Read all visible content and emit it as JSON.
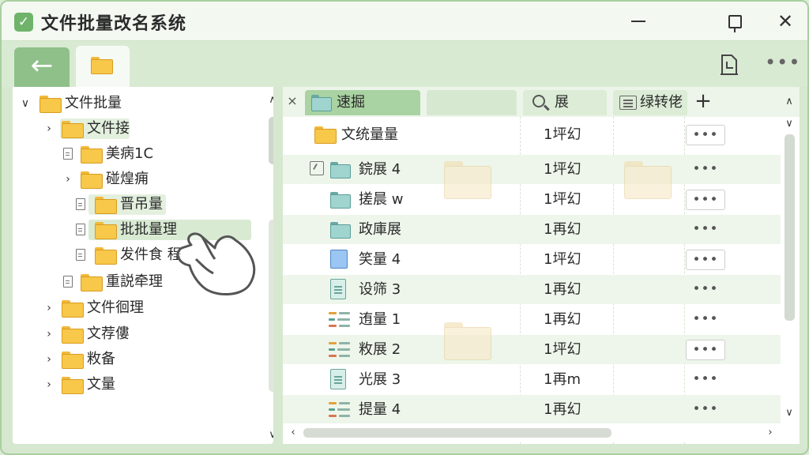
{
  "window": {
    "title": "文件批量改名系统",
    "icons": {
      "app": "check-icon",
      "minimize": "minimize-icon",
      "maximize": "maximize-icon",
      "close": "close-icon",
      "close_glyph": "✕"
    },
    "colors": {
      "accent": "#6fb36a",
      "background": "#d6e8cf",
      "highlight": "#e3f0de"
    }
  },
  "toolbar": {
    "back_glyph": "←",
    "more_glyph": "•••"
  },
  "tree": {
    "items": [
      {
        "label": "文件批量",
        "arrow": "∨",
        "has_doc": false
      },
      {
        "label": "文件接",
        "arrow": "›",
        "has_doc": false
      },
      {
        "label": "美病1C",
        "arrow": "",
        "has_doc": true
      },
      {
        "label": "碰煌痈",
        "arrow": "›",
        "has_doc": false
      },
      {
        "label": "晋吊量",
        "arrow": "",
        "has_doc": true
      },
      {
        "label": "批批量理",
        "arrow": "",
        "has_doc": true
      },
      {
        "label": "发件食 程",
        "arrow": "",
        "has_doc": true
      },
      {
        "label": "重説牵理",
        "arrow": "",
        "has_doc": true
      },
      {
        "label": "文件徊理",
        "arrow": "›",
        "has_doc": false
      },
      {
        "label": "文荐僂",
        "arrow": "›",
        "has_doc": false
      },
      {
        "label": "敉备",
        "arrow": "›",
        "has_doc": false
      },
      {
        "label": "文量",
        "arrow": "›",
        "has_doc": false
      }
    ],
    "scroll_up": "∧",
    "scroll_down": "∨"
  },
  "tabs": {
    "close_glyph": "×",
    "items": [
      {
        "label": "速掘"
      },
      {
        "label": ""
      },
      {
        "label": "展"
      },
      {
        "label": "绿转佬"
      }
    ],
    "add_glyph": "+"
  },
  "files": {
    "rows": [
      {
        "name": "文统量量",
        "size": "1坪幻",
        "icon": "folder-icon",
        "dots": "•••"
      },
      {
        "name": "鋎展 4",
        "size": "1坪幻",
        "icon": "teal-folder-icon",
        "dots": "•••"
      },
      {
        "name": "搓晨 w",
        "size": "1坪幻",
        "icon": "teal-folder-icon",
        "dots": "•••"
      },
      {
        "name": "政庫展",
        "size": "1再幻",
        "icon": "teal-folder-icon",
        "dots": "•••"
      },
      {
        "name": "笑量 4",
        "size": "1坪幻",
        "icon": "blue-file-icon",
        "dots": "•••"
      },
      {
        "name": "设筛 3",
        "size": "1再幻",
        "icon": "document-icon",
        "dots": "•••"
      },
      {
        "name": "迶量 1",
        "size": "1再幻",
        "icon": "list-file-icon",
        "dots": "•••"
      },
      {
        "name": "敉展 2",
        "size": "1坪幻",
        "icon": "list-file-icon",
        "dots": "•••"
      },
      {
        "name": "光展 3",
        "size": "1再m",
        "icon": "document-icon",
        "dots": "•••"
      },
      {
        "name": "提量 4",
        "size": "1再幻",
        "icon": "list-file-icon",
        "dots": "•••"
      }
    ],
    "scroll_up": "∧",
    "scroll_down": "∨",
    "scroll_left": "‹",
    "scroll_right": "›"
  }
}
